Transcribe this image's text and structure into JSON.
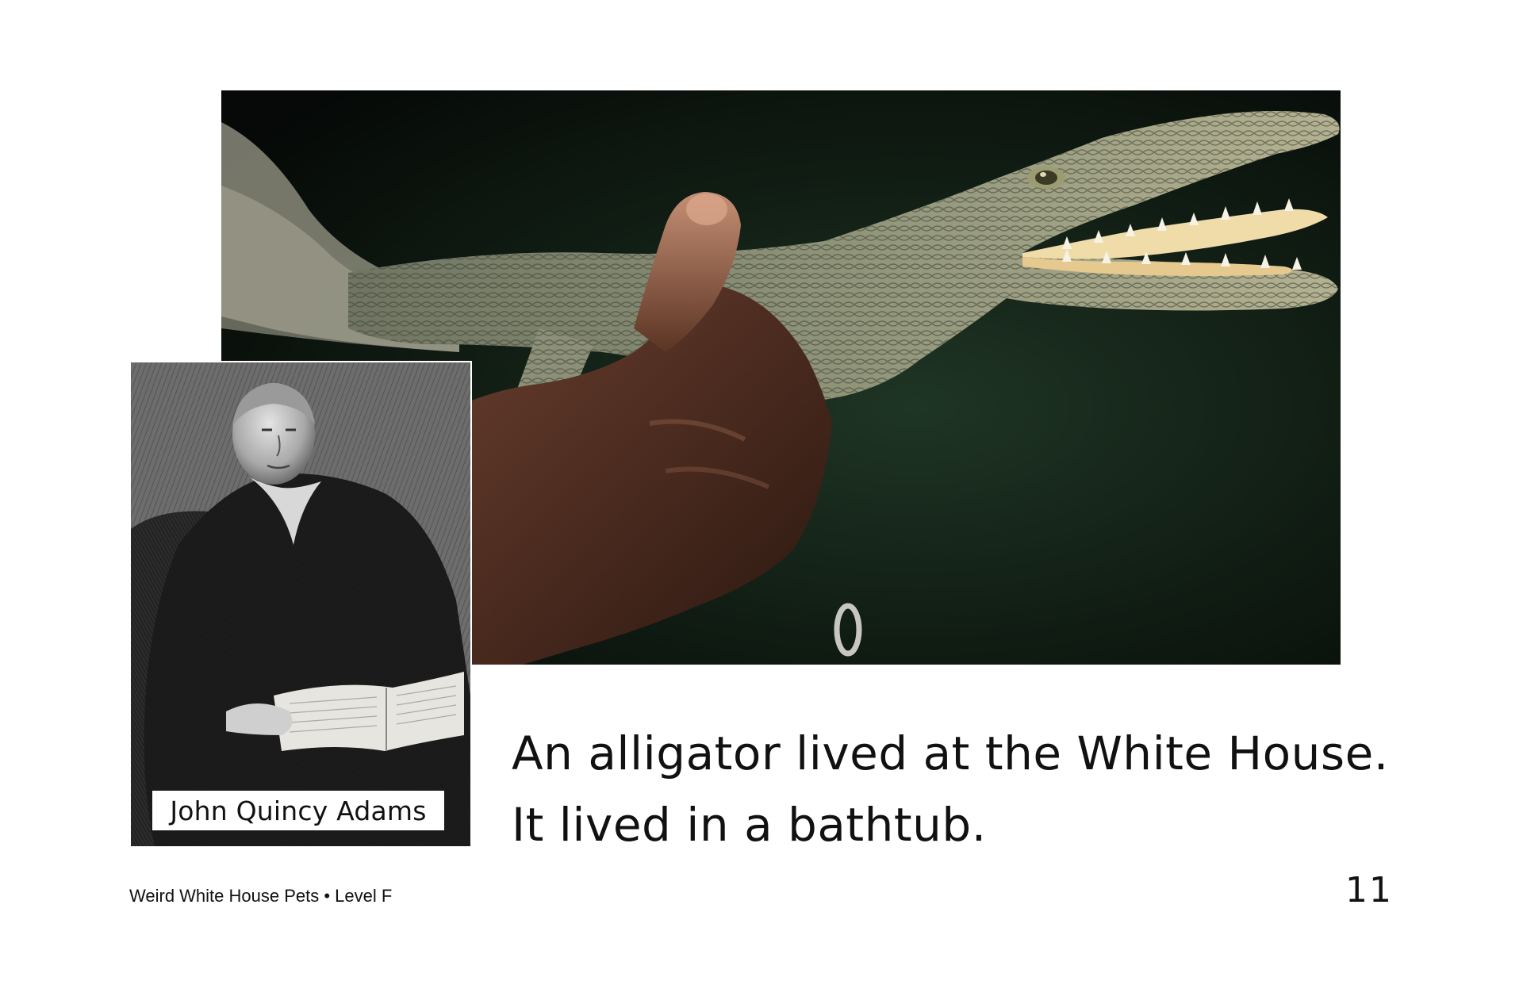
{
  "body_text": {
    "line1": "An alligator lived at the White House.",
    "line2": "It lived in a bathtub."
  },
  "portrait": {
    "caption": "John Quincy Adams"
  },
  "footer": {
    "book_title": "Weird White House Pets • Level F",
    "page_number": "11"
  },
  "colors": {
    "background": "#ffffff",
    "text": "#111111",
    "photo_background": "#0f1a12"
  }
}
